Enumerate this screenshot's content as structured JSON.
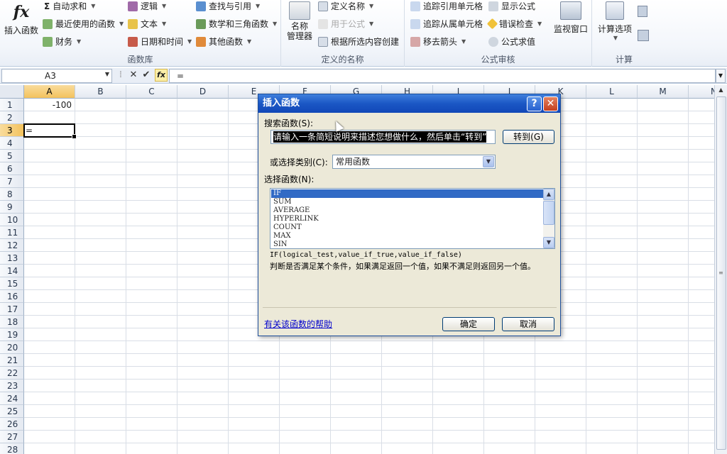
{
  "ribbon": {
    "function_library": {
      "label": "函数库",
      "insert_function": "插入函数",
      "autosum": "自动求和",
      "recent": "最近使用的函数",
      "financial": "财务",
      "logical": "逻辑",
      "text": "文本",
      "datetime": "日期和时间",
      "lookup": "查找与引用",
      "math": "数学和三角函数",
      "more": "其他函数"
    },
    "defined_names": {
      "label": "定义的名称",
      "name_manager": "名称\n管理器",
      "define_name": "定义名称",
      "use_in_formula": "用于公式",
      "create_from_selection": "根据所选内容创建"
    },
    "formula_auditing": {
      "label": "公式审核",
      "trace_precedents": "追踪引用单元格",
      "trace_dependents": "追踪从属单元格",
      "remove_arrows": "移去箭头",
      "show_formulas": "显示公式",
      "error_checking": "错误检查",
      "evaluate_formula": "公式求值",
      "watch_window": "监视窗口"
    },
    "calculation": {
      "label": "计算",
      "calc_options": "计算选项"
    }
  },
  "formula_bar": {
    "name_box": "A3",
    "formula": "="
  },
  "grid": {
    "columns": [
      "A",
      "B",
      "C",
      "D",
      "E",
      "F",
      "G",
      "H",
      "I",
      "J",
      "K",
      "L",
      "M",
      "N"
    ],
    "rows": [
      "1",
      "2",
      "3",
      "4",
      "5",
      "6",
      "7",
      "8",
      "9",
      "10",
      "11",
      "12",
      "13",
      "14",
      "15",
      "16",
      "17",
      "18",
      "19",
      "20",
      "21",
      "22",
      "23",
      "24",
      "25",
      "26",
      "27",
      "28"
    ],
    "a1": "-100",
    "a3": "="
  },
  "dialog": {
    "title": "插入函数",
    "search_label": "搜索函数(S):",
    "search_value": "请输入一条简短说明来描述您想做什么，然后单击“转到”",
    "go_button": "转到(G)",
    "category_label": "或选择类别(C):",
    "category_value": "常用函数",
    "select_label": "选择函数(N):",
    "functions": [
      "IF",
      "SUM",
      "AVERAGE",
      "HYPERLINK",
      "COUNT",
      "MAX",
      "SIN"
    ],
    "signature": "IF(logical_test,value_if_true,value_if_false)",
    "description": "判断是否满足某个条件，如果满足返回一个值，如果不满足则返回另一个值。",
    "help_link": "有关该函数的帮助",
    "ok": "确定",
    "cancel": "取消"
  }
}
